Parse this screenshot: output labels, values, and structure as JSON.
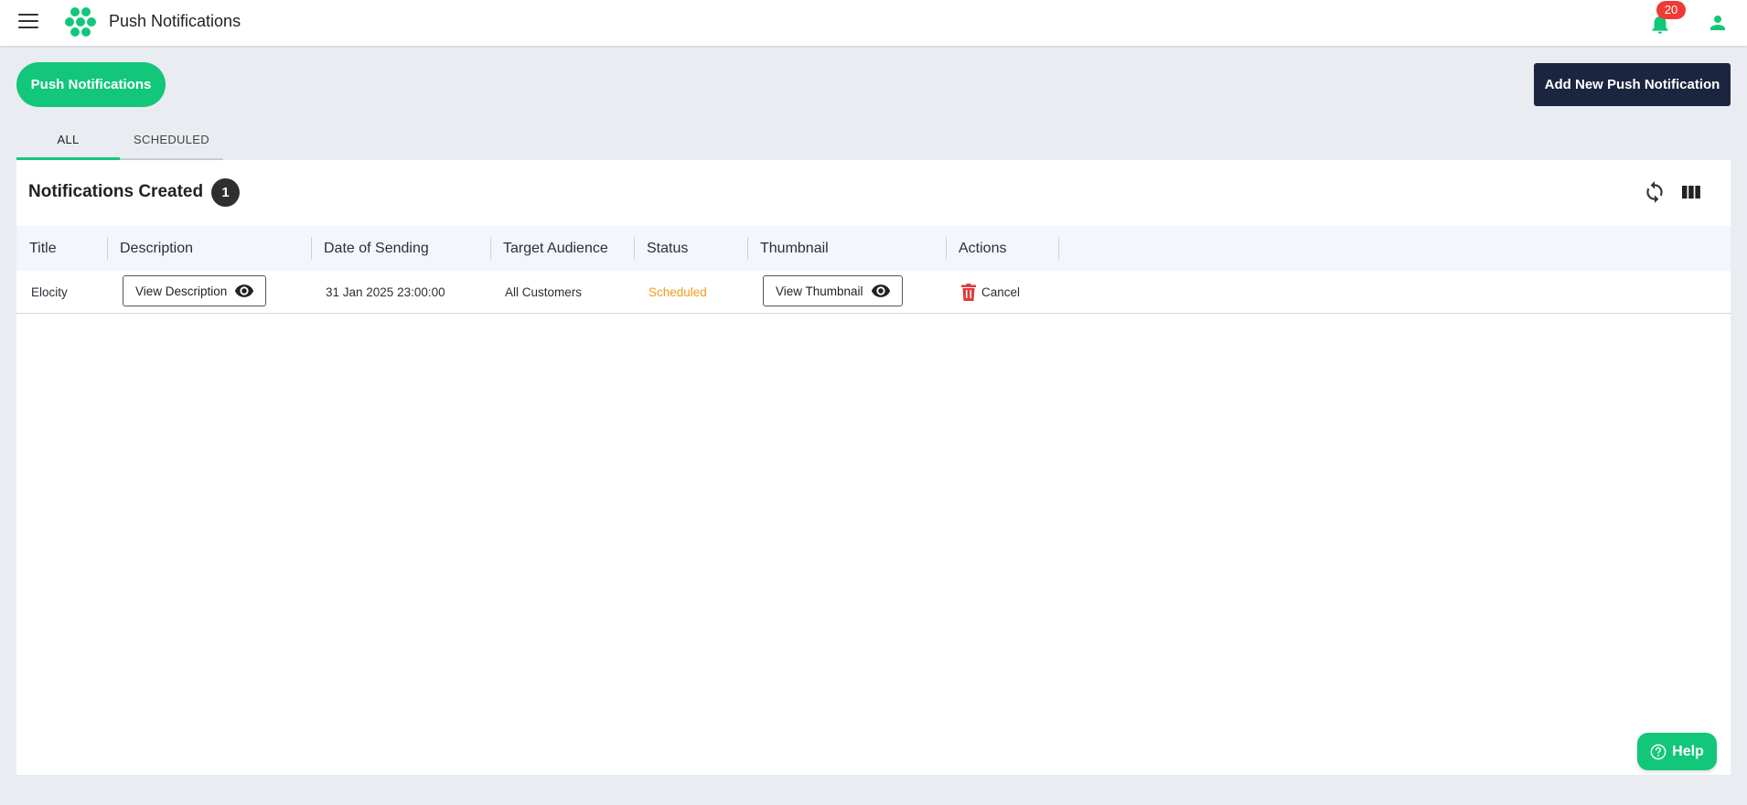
{
  "header": {
    "app_title": "Push Notifications",
    "notification_count": "20",
    "icons": [
      "menu-icon",
      "hexagon-logo-icon",
      "bell-icon",
      "user-icon"
    ]
  },
  "page": {
    "pill_button_label": "Push Notifications",
    "add_button_label": "Add New Push Notification"
  },
  "tabs": [
    {
      "label": "ALL",
      "active": true
    },
    {
      "label": "SCHEDULED",
      "active": false
    }
  ],
  "card": {
    "title": "Notifications Created",
    "count": "1"
  },
  "table": {
    "columns": [
      "Title",
      "Description",
      "Date of Sending",
      "Target Audience",
      "Status",
      "Thumbnail",
      "Actions"
    ],
    "rows": [
      {
        "title": "Elocity",
        "description_button": "View Description",
        "date": "31 Jan 2025 23:00:00",
        "audience": "All Customers",
        "status": "Scheduled",
        "thumbnail_button": "View Thumbnail",
        "action": "Cancel"
      }
    ]
  },
  "help_label": "Help",
  "colors": {
    "accent_green": "#12c77a",
    "navy": "#1c2540",
    "status_scheduled": "#f29a1a",
    "badge_red": "#ef3b33",
    "delete_red": "#e03b3b"
  }
}
